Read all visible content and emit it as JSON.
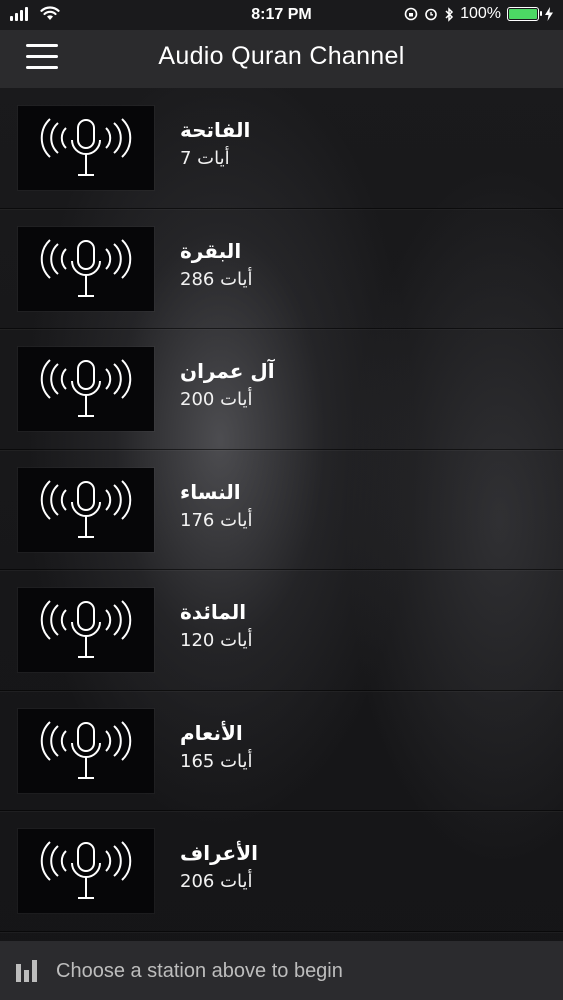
{
  "status": {
    "time": "8:17 PM",
    "battery_text": "100%",
    "battery_level": 1.0,
    "battery_color": "#4cd964"
  },
  "header": {
    "title": "Audio Quran Channel",
    "menu_icon": "hamburger-icon"
  },
  "surahs": [
    {
      "name": "الفاتحة",
      "count": "أيات 7"
    },
    {
      "name": "البقرة",
      "count": "أيات 286"
    },
    {
      "name": "آل عمران",
      "count": "أيات 200"
    },
    {
      "name": "النساء",
      "count": "أيات 176"
    },
    {
      "name": "المائدة",
      "count": "أيات 120"
    },
    {
      "name": "الأنعام",
      "count": "أيات 165"
    },
    {
      "name": "الأعراف",
      "count": "أيات 206"
    }
  ],
  "player": {
    "message": "Choose a station above to begin",
    "icon": "audio-bars-icon"
  }
}
